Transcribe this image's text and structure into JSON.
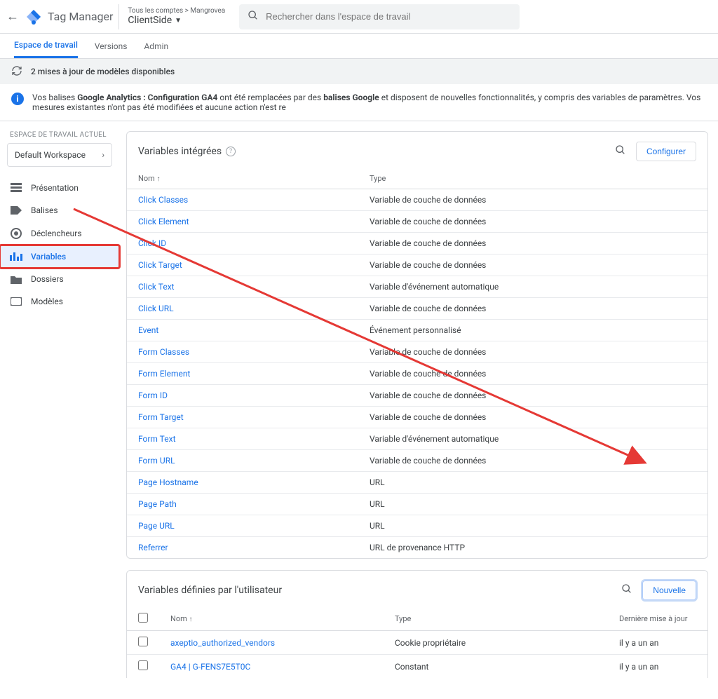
{
  "header": {
    "product_name": "Tag Manager",
    "breadcrumb_small_prefix": "Tous les comptes",
    "breadcrumb_small_account": "Mangrovea",
    "container_name": "ClientSide",
    "search_placeholder": "Rechercher dans l'espace de travail"
  },
  "tabs": {
    "workspace": "Espace de travail",
    "versions": "Versions",
    "admin": "Admin"
  },
  "update_banner": "2 mises à jour de modèles disponibles",
  "info_banner": {
    "prefix": "Vos balises ",
    "bold1": "Google Analytics : Configuration GA4",
    "mid": " ont été remplacées par des ",
    "bold2": "balises Google",
    "suffix": " et disposent de nouvelles fonctionnalités, y compris des variables de paramètres. Vos mesures existantes n'ont pas été modifiées et aucune action n'est re"
  },
  "sidebar": {
    "workspace_label": "ESPACE DE TRAVAIL ACTUEL",
    "workspace_name": "Default Workspace",
    "items": [
      {
        "label": "Présentation"
      },
      {
        "label": "Balises"
      },
      {
        "label": "Déclencheurs"
      },
      {
        "label": "Variables"
      },
      {
        "label": "Dossiers"
      },
      {
        "label": "Modèles"
      }
    ]
  },
  "builtin_vars": {
    "title": "Variables intégrées",
    "configure_label": "Configurer",
    "columns": {
      "name": "Nom",
      "type": "Type"
    },
    "rows": [
      {
        "name": "Click Classes",
        "type": "Variable de couche de données"
      },
      {
        "name": "Click Element",
        "type": "Variable de couche de données"
      },
      {
        "name": "Click ID",
        "type": "Variable de couche de données"
      },
      {
        "name": "Click Target",
        "type": "Variable de couche de données"
      },
      {
        "name": "Click Text",
        "type": "Variable d'événement automatique"
      },
      {
        "name": "Click URL",
        "type": "Variable de couche de données"
      },
      {
        "name": "Event",
        "type": "Événement personnalisé"
      },
      {
        "name": "Form Classes",
        "type": "Variable de couche de données"
      },
      {
        "name": "Form Element",
        "type": "Variable de couche de données"
      },
      {
        "name": "Form ID",
        "type": "Variable de couche de données"
      },
      {
        "name": "Form Target",
        "type": "Variable de couche de données"
      },
      {
        "name": "Form Text",
        "type": "Variable d'événement automatique"
      },
      {
        "name": "Form URL",
        "type": "Variable de couche de données"
      },
      {
        "name": "Page Hostname",
        "type": "URL"
      },
      {
        "name": "Page Path",
        "type": "URL"
      },
      {
        "name": "Page URL",
        "type": "URL"
      },
      {
        "name": "Referrer",
        "type": "URL de provenance HTTP"
      }
    ]
  },
  "user_vars": {
    "title": "Variables définies par l'utilisateur",
    "new_label": "Nouvelle",
    "columns": {
      "name": "Nom",
      "type": "Type",
      "last_modified": "Dernière mise à jour"
    },
    "rows": [
      {
        "name": "axeptio_authorized_vendors",
        "type": "Cookie propriétaire",
        "last_modified": "il y a un an"
      },
      {
        "name": "GA4 | G-FENS7E5T0C",
        "type": "Constant",
        "last_modified": "il y a un an"
      }
    ]
  }
}
